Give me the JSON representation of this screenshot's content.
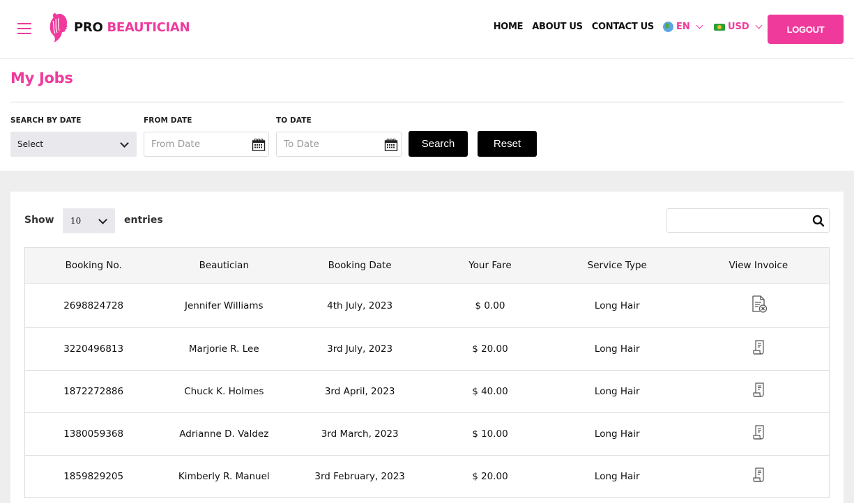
{
  "header": {
    "brand_part1": "PRO",
    "brand_part2": "BEAUTICIAN",
    "nav": [
      "HOME",
      "ABOUT US",
      "CONTACT US"
    ],
    "language": {
      "icon": "globe-icon",
      "value": "EN"
    },
    "currency": {
      "icon": "money-icon",
      "value": "USD"
    },
    "logout_label": "LOGOUT"
  },
  "page": {
    "title": "My Jobs"
  },
  "filters": {
    "search_by_date_label": "SEARCH BY DATE",
    "search_by_date_value": "Select",
    "from_date_label": "FROM DATE",
    "from_date_placeholder": "From Date",
    "to_date_label": "TO DATE",
    "to_date_placeholder": "To Date",
    "search_label": "Search",
    "reset_label": "Reset"
  },
  "table_controls": {
    "show_label": "Show",
    "entries_value": "10",
    "entries_label": "entries",
    "search_placeholder": ""
  },
  "table": {
    "headers": [
      "Booking No.",
      "Beautician",
      "Booking Date",
      "Your Fare",
      "Service Type",
      "View Invoice"
    ],
    "rows": [
      {
        "booking_no": "2698824728",
        "beautician": "Jennifer Williams",
        "date": "4th July, 2023",
        "fare": "$ 0.00",
        "service": "Long Hair",
        "invoice_icon": "invoice-cancelled-icon"
      },
      {
        "booking_no": "3220496813",
        "beautician": "Marjorie R. Lee",
        "date": "3rd July, 2023",
        "fare": "$ 20.00",
        "service": "Long Hair",
        "invoice_icon": "invoice-receipt-icon"
      },
      {
        "booking_no": "1872272886",
        "beautician": "Chuck K. Holmes",
        "date": "3rd April, 2023",
        "fare": "$ 40.00",
        "service": "Long Hair",
        "invoice_icon": "invoice-receipt-icon"
      },
      {
        "booking_no": "1380059368",
        "beautician": "Adrianne D. Valdez",
        "date": "3rd March, 2023",
        "fare": "$ 10.00",
        "service": "Long Hair",
        "invoice_icon": "invoice-receipt-icon"
      },
      {
        "booking_no": "1859829205",
        "beautician": "Kimberly R. Manuel",
        "date": "3rd February, 2023",
        "fare": "$ 20.00",
        "service": "Long Hair",
        "invoice_icon": "invoice-receipt-icon"
      }
    ]
  },
  "colors": {
    "brand_pink": "#ef3a9c",
    "button_dark": "#000000",
    "page_grey": "#eeeeee"
  }
}
